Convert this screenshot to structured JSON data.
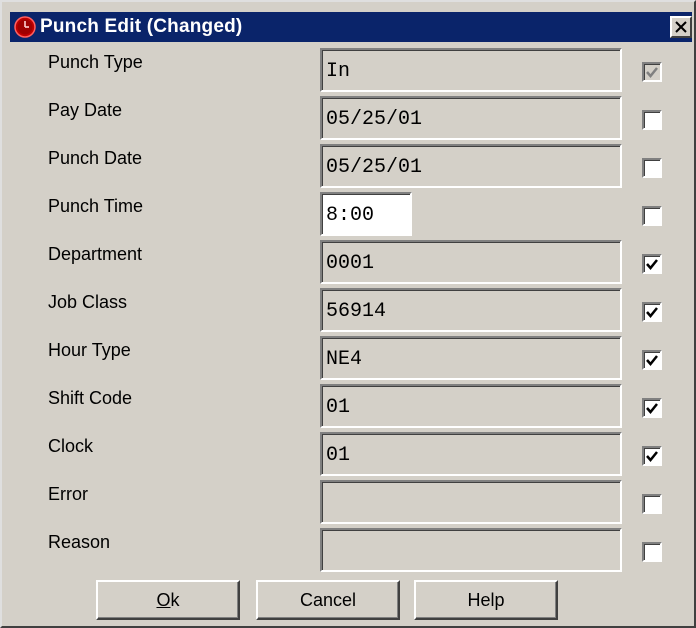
{
  "window": {
    "title": "Punch Edit (Changed)",
    "icon": "clock-icon",
    "close_glyph": "✕"
  },
  "rows": [
    {
      "label": "Punch Type",
      "value": "In",
      "checked": true,
      "disabled": true
    },
    {
      "label": "Pay Date",
      "value": "05/25/01",
      "checked": false,
      "disabled": false
    },
    {
      "label": "Punch Date",
      "value": "05/25/01",
      "checked": false,
      "disabled": false
    },
    {
      "label": "Punch Time",
      "value": "8:00",
      "checked": false,
      "disabled": false,
      "editable": true
    },
    {
      "label": "Department",
      "value": "0001",
      "checked": true,
      "disabled": false
    },
    {
      "label": "Job Class",
      "value": "56914",
      "checked": true,
      "disabled": false
    },
    {
      "label": "Hour Type",
      "value": "NE4",
      "checked": true,
      "disabled": false
    },
    {
      "label": "Shift Code",
      "value": "01",
      "checked": true,
      "disabled": false
    },
    {
      "label": "Clock",
      "value": "01",
      "checked": true,
      "disabled": false
    },
    {
      "label": "Error",
      "value": "",
      "checked": false,
      "disabled": false
    },
    {
      "label": "Reason",
      "value": "",
      "checked": false,
      "disabled": false
    }
  ],
  "buttons": {
    "ok_mnemonic": "O",
    "ok_rest": "k",
    "cancel": "Cancel",
    "help": "Help"
  },
  "colors": {
    "titlebar": "#0a246a",
    "face": "#d4d0c8",
    "check_disabled": "#808080"
  }
}
